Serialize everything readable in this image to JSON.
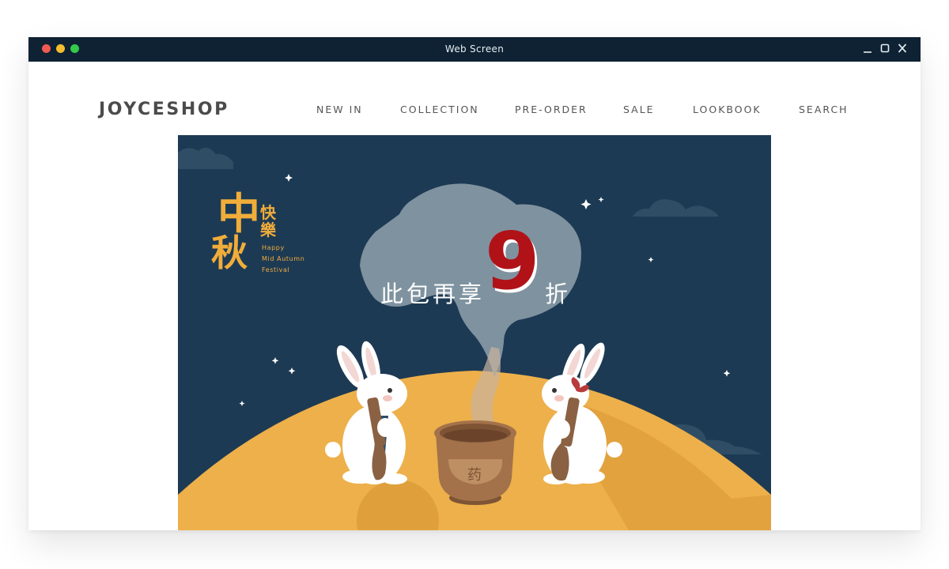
{
  "window": {
    "title": "Web Screen",
    "traffic_lights": {
      "close": "#ee5a52",
      "minimize": "#f5be2f",
      "maximize": "#35c94a"
    },
    "controls": [
      "minimize-icon",
      "maximize-icon",
      "close-icon"
    ]
  },
  "header": {
    "brand": "JOYCESHOP",
    "nav": [
      {
        "label": "NEW IN"
      },
      {
        "label": "COLLECTION"
      },
      {
        "label": "PRE-ORDER"
      },
      {
        "label": "SALE"
      },
      {
        "label": "LOOKBOOK"
      },
      {
        "label": "SEARCH"
      }
    ]
  },
  "banner": {
    "festival_cn_main_1": "中",
    "festival_cn_main_2": "秋",
    "festival_cn_side_1": "快",
    "festival_cn_side_2": "樂",
    "festival_en_1": "Happy",
    "festival_en_2": "Mid Autumn",
    "festival_en_3": "Festival",
    "promo_prefix": "此包再享",
    "promo_number": "9",
    "promo_suffix": "折",
    "mortar_label": "药",
    "colors": {
      "sky": "#1d3a54",
      "moon": "#edb04a",
      "cloud": "#2f4e65",
      "smoke": "#7f929f",
      "promo_number": "#b01218"
    }
  }
}
